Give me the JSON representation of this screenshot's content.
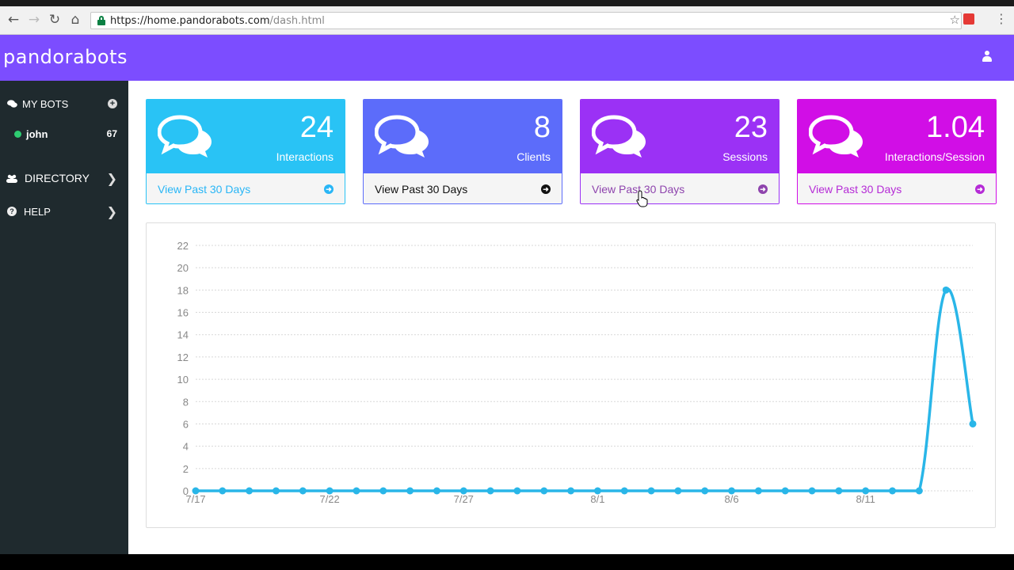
{
  "browser": {
    "back_icon": "arrow-left-icon",
    "forward_icon": "arrow-right-icon",
    "reload_icon": "reload-icon",
    "home_icon": "home-icon",
    "url_host": "https://home.pandorabots.com",
    "url_path": "/dash.html"
  },
  "header": {
    "brand": "pandorabots",
    "user_icon": "user-icon",
    "color": "#7c4dff"
  },
  "sidebar": {
    "background": "#1f2a2e",
    "my_bots": {
      "label": "MY BOTS",
      "icon": "comments-icon",
      "add_icon": "plus-circle-icon"
    },
    "bots": [
      {
        "name": "john",
        "count": "67",
        "status": "online"
      }
    ],
    "directory": {
      "label": "DIRECTORY",
      "icon": "users-icon"
    },
    "help": {
      "label": "HELP",
      "icon": "question-circle-icon"
    }
  },
  "cards": [
    {
      "value": "24",
      "label": "Interactions",
      "link": "View Past 30 Days",
      "color": "#29c3f5",
      "link_color": "#29b6f6"
    },
    {
      "value": "8",
      "label": "Clients",
      "link": "View Past 30 Days",
      "color": "#5c6cfa",
      "link_color": "#111111"
    },
    {
      "value": "23",
      "label": "Sessions",
      "link": "View Past 30 Days",
      "color": "#9b31f5",
      "link_color": "#8e44ad"
    },
    {
      "value": "1.04",
      "label": "Interactions/Session",
      "link": "View Past 30 Days",
      "color": "#d10ee6",
      "link_color": "#b52bd6"
    }
  ],
  "chart_data": {
    "type": "line",
    "x": [
      "7/17",
      "7/18",
      "7/19",
      "7/20",
      "7/21",
      "7/22",
      "7/23",
      "7/24",
      "7/25",
      "7/26",
      "7/27",
      "7/28",
      "7/29",
      "7/30",
      "7/31",
      "8/1",
      "8/2",
      "8/3",
      "8/4",
      "8/5",
      "8/6",
      "8/7",
      "8/8",
      "8/9",
      "8/10",
      "8/11",
      "8/12",
      "8/13",
      "8/14",
      "8/15"
    ],
    "x_tick_labels": [
      "7/17",
      "7/22",
      "7/27",
      "8/1",
      "8/6",
      "8/11"
    ],
    "series": [
      {
        "values": [
          0,
          0,
          0,
          0,
          0,
          0,
          0,
          0,
          0,
          0,
          0,
          0,
          0,
          0,
          0,
          0,
          0,
          0,
          0,
          0,
          0,
          0,
          0,
          0,
          0,
          0,
          0,
          0,
          18,
          6
        ],
        "color": "#29b6e8"
      }
    ],
    "yticks": [
      0,
      2,
      4,
      6,
      8,
      10,
      12,
      14,
      16,
      18,
      20,
      22
    ],
    "ylim": [
      0,
      22
    ],
    "grid": true,
    "legend": "none"
  }
}
